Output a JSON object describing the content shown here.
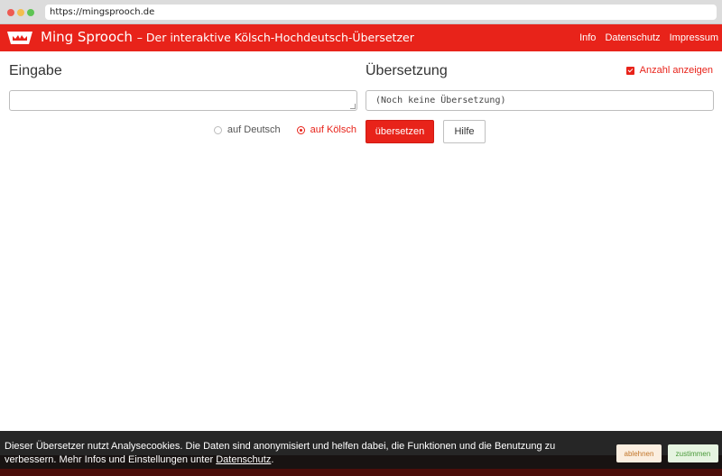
{
  "browser": {
    "url": "https://mingsprooch.de"
  },
  "header": {
    "logo_icon": "crown-logo-icon",
    "brand": "Ming Sprooch",
    "subtitle": "– Der interaktive Kölsch-Hochdeutsch-Übersetzer",
    "nav": [
      "Info",
      "Datenschutz",
      "Impressum"
    ]
  },
  "input": {
    "heading": "Eingabe",
    "value": "",
    "source_options": [
      {
        "label": "auf Deutsch",
        "selected": false
      },
      {
        "label": "auf Kölsch",
        "selected": true
      }
    ]
  },
  "output": {
    "heading": "Übersetzung",
    "show_count_label": "Anzahl anzeigen",
    "show_count_checked": true,
    "value": "(Noch keine Übersetzung)"
  },
  "actions": {
    "translate_label": "übersetzen",
    "help_label": "Hilfe"
  },
  "cookie": {
    "text_before_link": "Dieser Übersetzer nutzt Analysecookies. Die Daten sind anonymisiert und helfen dabei, die Funktionen und die Benutzung zu verbessern. Mehr Infos und Einstellungen unter ",
    "link_label": "Datenschutz",
    "text_after_link": ".",
    "decline_label": "ablehnen",
    "accept_label": "zustimmen"
  },
  "colors": {
    "accent": "#e8231a"
  }
}
